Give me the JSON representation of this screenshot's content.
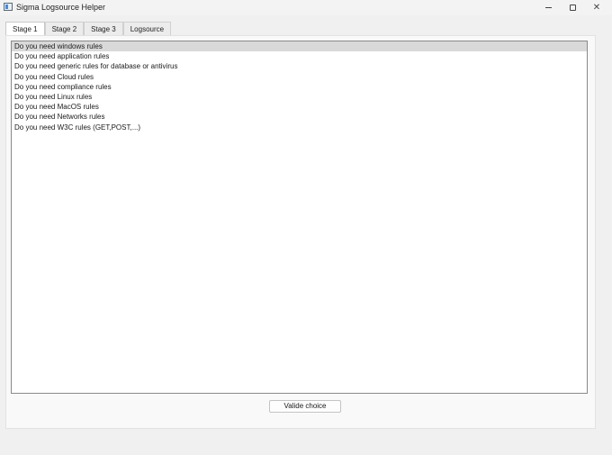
{
  "window": {
    "title": "Sigma Logsource Helper",
    "minimize_icon": "minimize-icon",
    "maximize_icon": "maximize-icon",
    "close_icon": "close-icon"
  },
  "tabs": [
    {
      "label": "Stage 1",
      "active": true
    },
    {
      "label": "Stage 2",
      "active": false
    },
    {
      "label": "Stage 3",
      "active": false
    },
    {
      "label": "Logsource",
      "active": false
    }
  ],
  "list": {
    "selected_index": 0,
    "items": [
      "Do you need windows rules",
      "Do you need application rules",
      "Do you need generic rules for database or antivirus",
      "Do you need Cloud rules",
      "Do you need compliance rules",
      "Do you need Linux rules",
      "Do you need MacOS rules",
      "Do you need Networks rules",
      "Do you need W3C rules (GET,POST,...)"
    ]
  },
  "actions": {
    "validate_label": "Valide choice"
  }
}
